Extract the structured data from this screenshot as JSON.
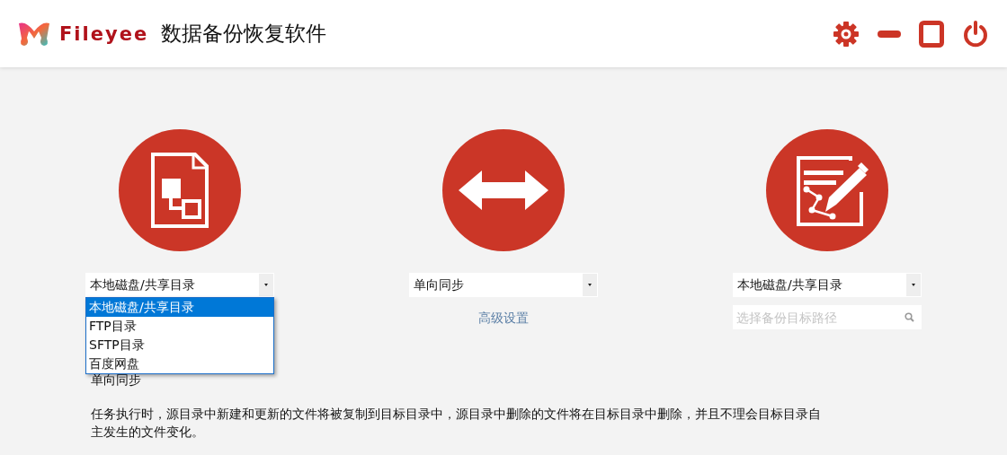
{
  "header": {
    "brand": "Fileyee",
    "title": "数据备份恢复软件"
  },
  "source": {
    "value": "本地磁盘/共享目录",
    "open": true,
    "options": [
      {
        "label": "本地磁盘/共享目录",
        "selected": true
      },
      {
        "label": "FTP目录",
        "selected": false
      },
      {
        "label": "SFTP目录",
        "selected": false
      },
      {
        "label": "百度网盘",
        "selected": false
      }
    ]
  },
  "mode": {
    "value": "单向同步",
    "advanced_link": "高级设置"
  },
  "target": {
    "value": "本地磁盘/共享目录",
    "path_placeholder": "选择备份目标路径"
  },
  "mode_label": "单向同步",
  "description": "任务执行时，源目录中新建和更新的文件将被复制到目标目录中，源目录中删除的文件将在目标目录中删除，并且不理会目标目录自主发生的文件变化。"
}
